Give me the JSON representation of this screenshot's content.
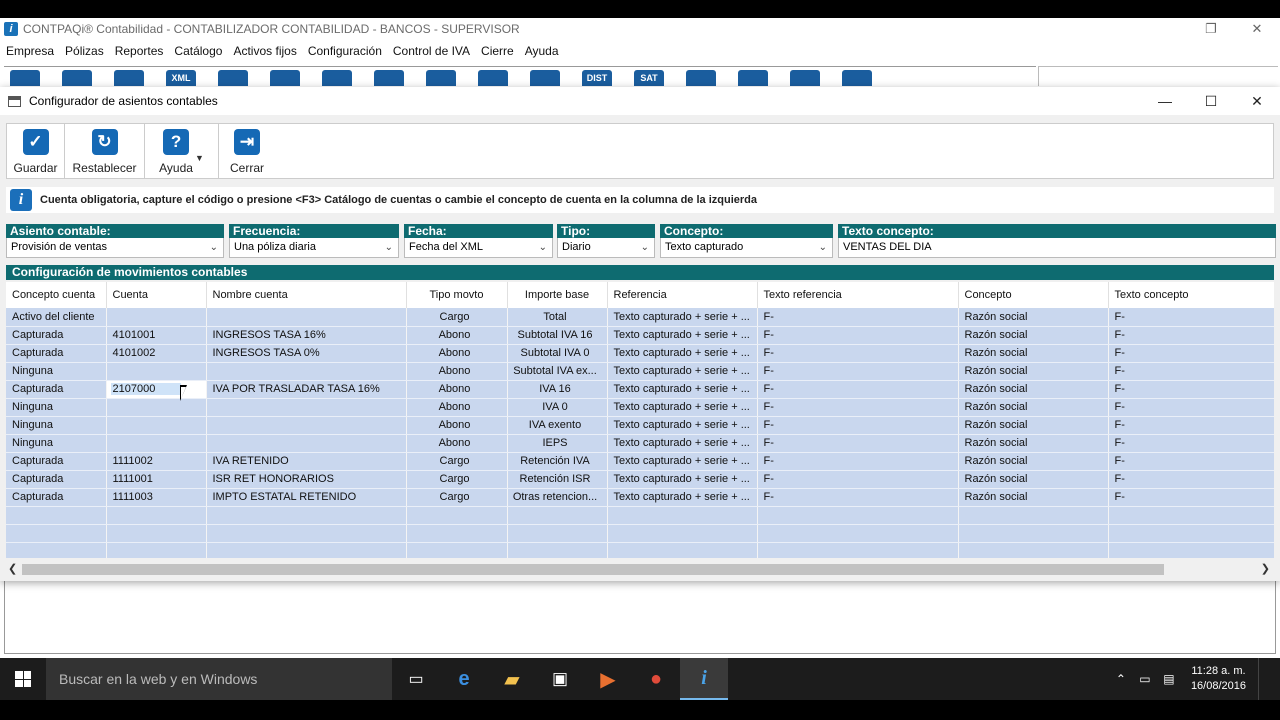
{
  "app": {
    "title": "CONTPAQi® Contabilidad - CONTABILIZADOR CONTABILIDAD - BANCOS - SUPERVISOR",
    "logo": "i",
    "menu": [
      "Empresa",
      "Pólizas",
      "Reportes",
      "Catálogo",
      "Activos fijos",
      "Configuración",
      "Control de IVA",
      "Cierre",
      "Ayuda"
    ],
    "toolbar_icons": [
      "home-icon",
      "search-icon",
      "document-icon",
      "xml-icon",
      "list-icon",
      "form-icon",
      "form2-icon",
      "grid-icon",
      "form3-icon",
      "print-icon",
      "text-icon",
      "dist-icon",
      "sat-icon",
      "chart-icon",
      "export-icon",
      "users-icon",
      "exit-icon"
    ],
    "toolbar_labels": [
      "",
      "",
      "",
      "XML",
      "",
      "",
      "",
      "",
      "",
      "",
      "",
      "DIST",
      "SAT",
      "",
      "",
      "",
      ""
    ]
  },
  "dialog": {
    "title": "Configurador de asientos contables",
    "toolbar": {
      "guardar": "Guardar",
      "restablecer": "Restablecer",
      "ayuda": "Ayuda",
      "cerrar": "Cerrar"
    },
    "info": "Cuenta obligatoria, capture el código o presione <F3> Catálogo de cuentas o cambie el concepto de cuenta en la columna de la izquierda",
    "fields": {
      "asiento_label": "Asiento contable:",
      "asiento_value": "Provisión de ventas",
      "frecuencia_label": "Frecuencia:",
      "frecuencia_value": "Una póliza diaria",
      "fecha_label": "Fecha:",
      "fecha_value": "Fecha del XML",
      "tipo_label": "Tipo:",
      "tipo_value": "Diario",
      "concepto_label": "Concepto:",
      "concepto_value": "Texto capturado",
      "texto_concepto_label": "Texto concepto:",
      "texto_concepto_value": "VENTAS DEL DIA"
    },
    "movements_header": "Configuración de movimientos contables",
    "columns": [
      "Concepto cuenta",
      "Cuenta",
      "Nombre cuenta",
      "Tipo movto",
      "Importe base",
      "Referencia",
      "Texto referencia",
      "Concepto",
      "Texto concepto"
    ],
    "rows": [
      [
        "Activo del cliente",
        "",
        "",
        "Cargo",
        "Total",
        "Texto capturado + serie + ...",
        "F-",
        "Razón social",
        "F-"
      ],
      [
        "Capturada",
        "4101001",
        "INGRESOS TASA 16%",
        "Abono",
        "Subtotal IVA 16",
        "Texto capturado + serie + ...",
        "F-",
        "Razón social",
        "F-"
      ],
      [
        "Capturada",
        "4101002",
        "INGRESOS TASA 0%",
        "Abono",
        "Subtotal IVA 0",
        "Texto capturado + serie + ...",
        "F-",
        "Razón social",
        "F-"
      ],
      [
        "Ninguna",
        "",
        "",
        "Abono",
        "Subtotal IVA ex...",
        "Texto capturado + serie + ...",
        "F-",
        "Razón social",
        "F-"
      ],
      [
        "Capturada",
        "2107000",
        "IVA POR TRASLADAR TASA 16%",
        "Abono",
        "IVA 16",
        "Texto capturado + serie + ...",
        "F-",
        "Razón social",
        "F-"
      ],
      [
        "Ninguna",
        "",
        "",
        "Abono",
        "IVA 0",
        "Texto capturado + serie + ...",
        "F-",
        "Razón social",
        "F-"
      ],
      [
        "Ninguna",
        "",
        "",
        "Abono",
        "IVA exento",
        "Texto capturado + serie + ...",
        "F-",
        "Razón social",
        "F-"
      ],
      [
        "Ninguna",
        "",
        "",
        "Abono",
        "IEPS",
        "Texto capturado + serie + ...",
        "F-",
        "Razón social",
        "F-"
      ],
      [
        "Capturada",
        "1111002",
        "IVA RETENIDO",
        "Cargo",
        "Retención IVA",
        "Texto capturado + serie + ...",
        "F-",
        "Razón social",
        "F-"
      ],
      [
        "Capturada",
        "1111001",
        "ISR RET HONORARIOS",
        "Cargo",
        "Retención ISR",
        "Texto capturado + serie + ...",
        "F-",
        "Razón social",
        "F-"
      ],
      [
        "Capturada",
        "1111003",
        "IMPTO ESTATAL RETENIDO",
        "Cargo",
        "Otras retencion...",
        "Texto capturado + serie + ...",
        "F-",
        "Razón social",
        "F-"
      ]
    ],
    "empty_rows": 3
  },
  "taskbar": {
    "search_placeholder": "Buscar en la web y en Windows",
    "time": "11:28 a. m.",
    "date": "16/08/2016"
  },
  "colors": {
    "teal_header": "#0e6b70",
    "row_blue": "#c9d7ee",
    "accent_blue": "#1569b5"
  }
}
